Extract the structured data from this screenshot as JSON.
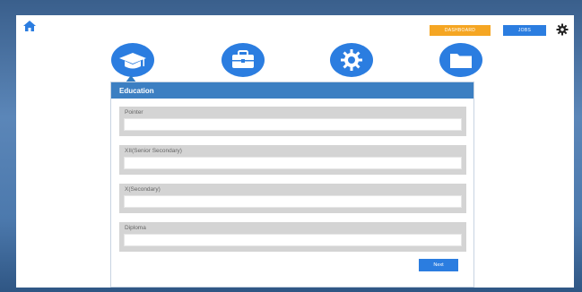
{
  "topbar": {
    "home_icon": "home-icon",
    "dashboard_label": "DASHBOARD",
    "jobs_label": "JOBS",
    "settings_icon": "gear-icon"
  },
  "colors": {
    "accent_blue": "#3c7fc2",
    "orange": "#f5a623",
    "button_blue": "#2b7de0",
    "field_bg": "#d4d4d4"
  },
  "steps": [
    {
      "icon": "graduation-cap-icon",
      "active": true
    },
    {
      "icon": "briefcase-icon",
      "active": false
    },
    {
      "icon": "gear-icon",
      "active": false
    },
    {
      "icon": "folder-icon",
      "active": false
    }
  ],
  "panel": {
    "title": "Education",
    "fields": [
      {
        "label": "Pointer",
        "value": ""
      },
      {
        "label": "XII(Senior Secondary)",
        "value": ""
      },
      {
        "label": "X(Secondary)",
        "value": ""
      },
      {
        "label": "Diploma",
        "value": ""
      }
    ],
    "next_label": "Next"
  }
}
